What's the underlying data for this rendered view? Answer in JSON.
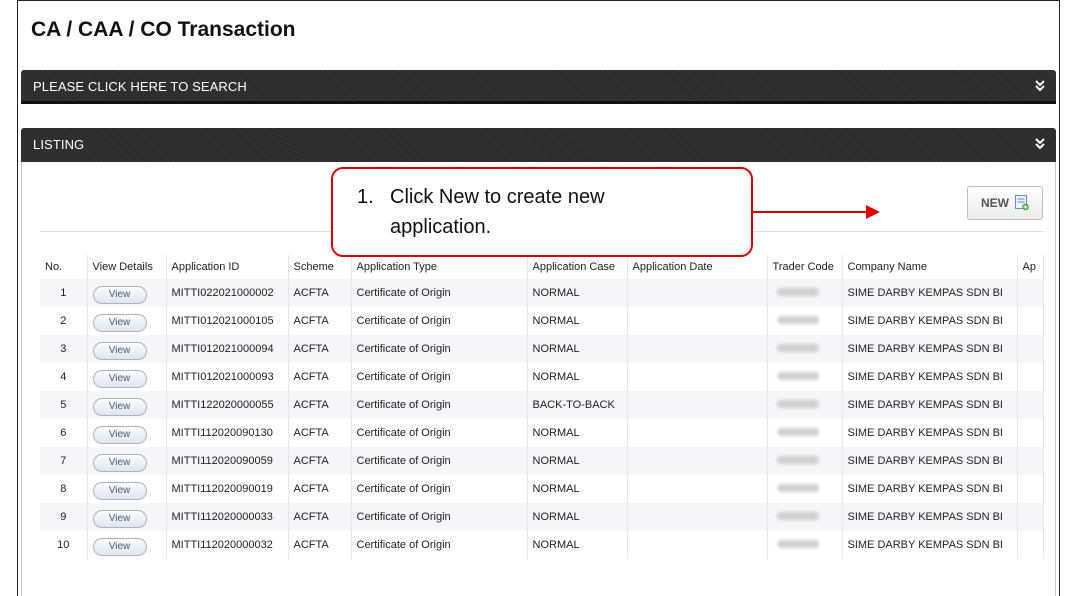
{
  "page": {
    "title": "CA / CAA / CO Transaction"
  },
  "search_panel": {
    "label": "PLEASE CLICK HERE TO SEARCH",
    "icon": "double-chevron-down-icon"
  },
  "listing_panel": {
    "label": "LISTING",
    "icon": "double-chevron-down-icon"
  },
  "toolbar": {
    "new_label": "NEW",
    "new_icon": "new-document-icon"
  },
  "callout": {
    "number": "1.",
    "line1": "Click New to create new",
    "line2": "application."
  },
  "table": {
    "columns": [
      "No.",
      "View Details",
      "Application ID",
      "Scheme",
      "Application Type",
      "Application Case",
      "Application Date",
      "Trader Code",
      "Company Name",
      "Ap"
    ],
    "view_label": "View",
    "rows": [
      {
        "no": "1",
        "app_id": "MITTI022021000002",
        "scheme": "ACFTA",
        "type": "Certificate of Origin",
        "case": "NORMAL",
        "date": "",
        "company": "SIME DARBY KEMPAS SDN BI"
      },
      {
        "no": "2",
        "app_id": "MITTI012021000105",
        "scheme": "ACFTA",
        "type": "Certificate of Origin",
        "case": "NORMAL",
        "date": "",
        "company": "SIME DARBY KEMPAS SDN BI"
      },
      {
        "no": "3",
        "app_id": "MITTI012021000094",
        "scheme": "ACFTA",
        "type": "Certificate of Origin",
        "case": "NORMAL",
        "date": "",
        "company": "SIME DARBY KEMPAS SDN BI"
      },
      {
        "no": "4",
        "app_id": "MITTI012021000093",
        "scheme": "ACFTA",
        "type": "Certificate of Origin",
        "case": "NORMAL",
        "date": "",
        "company": "SIME DARBY KEMPAS SDN BI"
      },
      {
        "no": "5",
        "app_id": "MITTI122020000055",
        "scheme": "ACFTA",
        "type": "Certificate of Origin",
        "case": "BACK-TO-BACK",
        "date": "",
        "company": "SIME DARBY KEMPAS SDN BI"
      },
      {
        "no": "6",
        "app_id": "MITTI112020090130",
        "scheme": "ACFTA",
        "type": "Certificate of Origin",
        "case": "NORMAL",
        "date": "",
        "company": "SIME DARBY KEMPAS SDN BI"
      },
      {
        "no": "7",
        "app_id": "MITTI112020090059",
        "scheme": "ACFTA",
        "type": "Certificate of Origin",
        "case": "NORMAL",
        "date": "",
        "company": "SIME DARBY KEMPAS SDN BI"
      },
      {
        "no": "8",
        "app_id": "MITTI112020090019",
        "scheme": "ACFTA",
        "type": "Certificate of Origin",
        "case": "NORMAL",
        "date": "",
        "company": "SIME DARBY KEMPAS SDN BI"
      },
      {
        "no": "9",
        "app_id": "MITTI112020000033",
        "scheme": "ACFTA",
        "type": "Certificate of Origin",
        "case": "NORMAL",
        "date": "",
        "company": "SIME DARBY KEMPAS SDN BI"
      },
      {
        "no": "10",
        "app_id": "MITTI112020000032",
        "scheme": "ACFTA",
        "type": "Certificate of Origin",
        "case": "NORMAL",
        "date": "",
        "company": "SIME DARBY KEMPAS SDN BI"
      }
    ]
  },
  "colors": {
    "callout_border": "#e00000",
    "panel_bar": "#2b2b2b",
    "row_stripe": "#f4f6fa"
  }
}
